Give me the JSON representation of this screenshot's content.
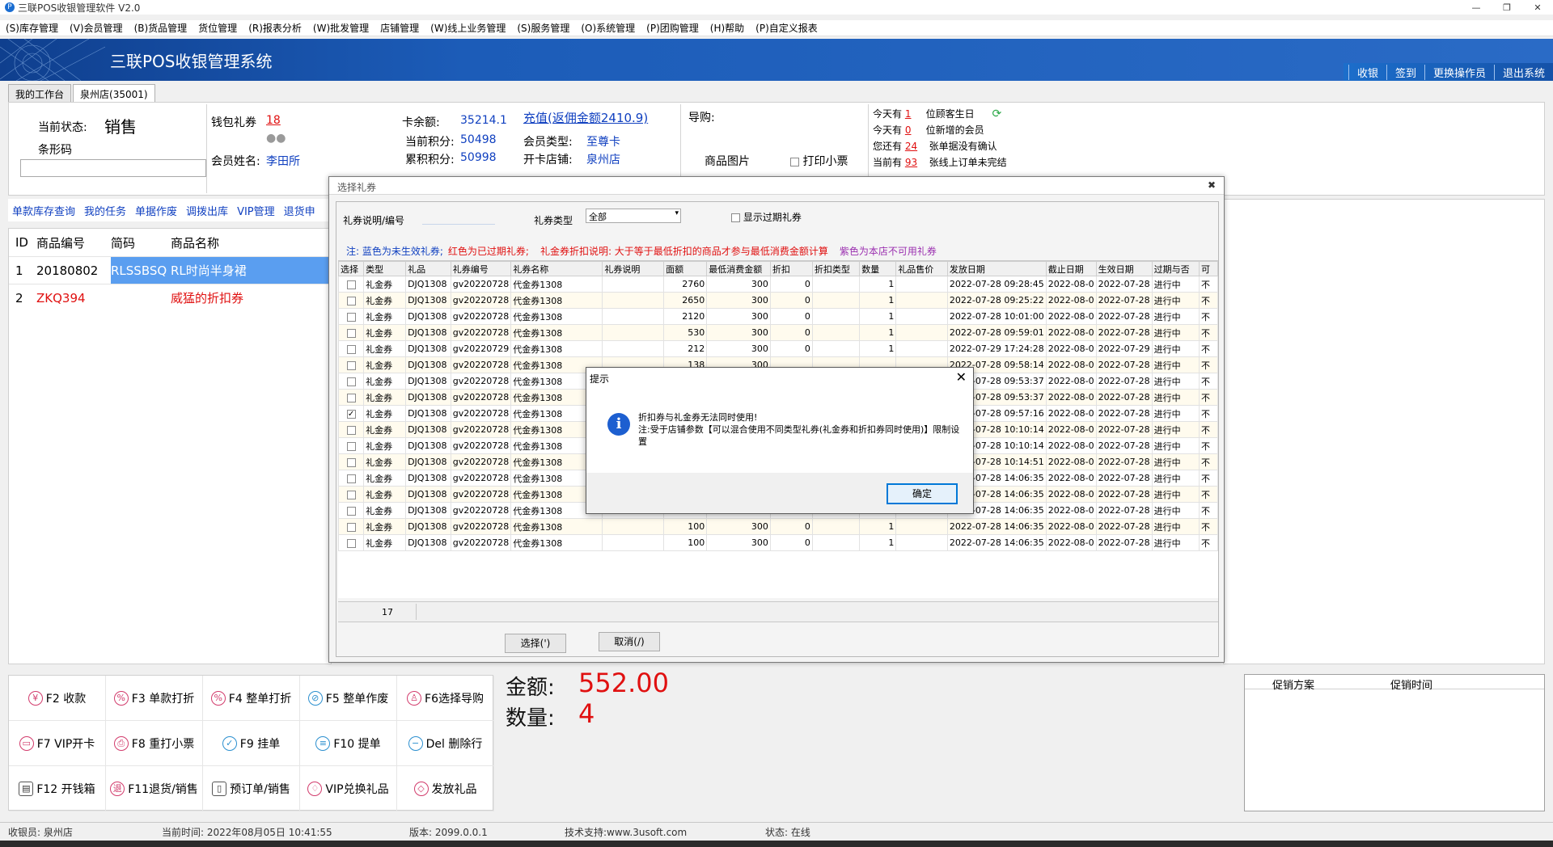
{
  "window": {
    "title": "三联POS收银管理软件 V2.0",
    "minimize": "—",
    "restore": "❐",
    "close": "✕"
  },
  "menu": [
    "(S)库存管理",
    "(V)会员管理",
    "(B)货品管理",
    "货位管理",
    "(R)报表分析",
    "(W)批发管理",
    "店铺管理",
    "(W)线上业务管理",
    "(S)服务管理",
    "(O)系统管理",
    "(P)团购管理",
    "(H)帮助",
    "(P)自定义报表"
  ],
  "banner": {
    "title": "三联POS收银管理系统",
    "links": [
      "收银",
      "签到",
      "更换操作员",
      "退出系统"
    ]
  },
  "tabs": [
    "我的工作台",
    "泉州店(35001)"
  ],
  "status": {
    "state_label": "当前状态:",
    "state_value": "销售",
    "barcode_label": "条形码",
    "wallet_label": "钱包礼券",
    "wallet_value": "18",
    "member_label": "会员姓名:",
    "member_value": "李田所",
    "balance_label": "卡余额:",
    "balance_value": "35214.1",
    "recharge_link": "充值(返佣金额2410.9)",
    "points_label": "当前积分:",
    "points_value": "50498",
    "total_points_label": "累积积分:",
    "total_points_value": "50998",
    "member_type_label": "会员类型:",
    "member_type_value": "至尊卡",
    "store_label": "开卡店铺:",
    "store_value": "泉州店",
    "guide_label": "导购:",
    "product_image_label": "商品图片",
    "print_ticket_label": "打印小票"
  },
  "notices": [
    {
      "prefix": "今天有",
      "count": "1",
      "suffix": "位顾客生日"
    },
    {
      "prefix": "今天有",
      "count": "0",
      "suffix": "位新增的会员"
    },
    {
      "prefix": "您还有",
      "count": "24",
      "suffix": "张单据没有确认"
    },
    {
      "prefix": "当前有",
      "count": "93",
      "suffix": "张线上订单未完结"
    }
  ],
  "toolbar_links": [
    "单款库存查询",
    "我的任务",
    "单据作废",
    "调拨出库",
    "VIP管理",
    "退货申"
  ],
  "product_table": {
    "headers": [
      "ID",
      "商品编号",
      "简码",
      "商品名称"
    ],
    "rows": [
      {
        "id": "1",
        "code": "20180802",
        "short": "RLSSBSQ",
        "name": "RL时尚半身裙"
      },
      {
        "id": "2",
        "code": "ZKQ394",
        "short": "",
        "name": "威猛的折扣券"
      }
    ]
  },
  "fkeys": [
    {
      "icon": "yuan-icon",
      "glyph": "¥",
      "label": "F2 收款"
    },
    {
      "icon": "percent-icon",
      "glyph": "%",
      "label": "F3 单款打折"
    },
    {
      "icon": "percent-icon",
      "glyph": "%",
      "label": "F4 整单打折"
    },
    {
      "icon": "void-icon",
      "glyph": "⊘",
      "label": "F5 整单作废"
    },
    {
      "icon": "person-icon",
      "glyph": "♙",
      "label": "F6选择导购"
    },
    {
      "icon": "vip-card-icon",
      "glyph": "▭",
      "label": "F7 VIP开卡"
    },
    {
      "icon": "reprint-icon",
      "glyph": "⎙",
      "label": "F8 重打小票"
    },
    {
      "icon": "hold-icon",
      "glyph": "✓",
      "label": "F9 挂单"
    },
    {
      "icon": "retrieve-icon",
      "glyph": "≡",
      "label": "F10 提单"
    },
    {
      "icon": "delete-icon",
      "glyph": "−",
      "label": "Del 删除行"
    },
    {
      "icon": "cash-drawer-icon",
      "glyph": "▤",
      "label": "F12 开钱箱"
    },
    {
      "icon": "return-icon",
      "glyph": "退",
      "label": "F11退货/销售"
    },
    {
      "icon": "preorder-icon",
      "glyph": "▯",
      "label": "预订单/销售"
    },
    {
      "icon": "gift-icon",
      "glyph": "♢",
      "label": "VIP兑换礼品"
    },
    {
      "icon": "ticket-icon",
      "glyph": "◇",
      "label": "发放礼品"
    }
  ],
  "totals": {
    "amount_label": "金额:",
    "amount_value": "552.00",
    "qty_label": "数量:",
    "qty_value": "4"
  },
  "promo": {
    "headers": [
      "促销方案",
      "促销时间"
    ]
  },
  "statusbar": {
    "cashier": "收银员: 泉州店",
    "time": "当前时间: 2022年08月05日 10:41:55",
    "version": "版本: 2099.0.0.1",
    "support": "技术支持:www.3usoft.com",
    "state": "状态: 在线"
  },
  "voucher_dialog": {
    "title": "选择礼券",
    "desc_label": "礼券说明/编号",
    "type_label": "礼券类型",
    "type_value": "全部",
    "show_expired_label": "显示过期礼券",
    "notes": [
      "注: 蓝色为未生效礼券;",
      "红色为已过期礼券;",
      "礼金券折扣说明: 大于等于最低折扣的商品才参与最低消费金额计算",
      "紫色为本店不可用礼券"
    ],
    "columns": [
      "选择",
      "类型",
      "礼品",
      "礼券编号",
      "礼券名称",
      "礼券说明",
      "面额",
      "最低消费金额",
      "折扣",
      "折扣类型",
      "数量",
      "礼品售价",
      "发放日期",
      "截止日期",
      "生效日期",
      "过期与否",
      "可"
    ],
    "rows": [
      {
        "checked": false,
        "type": "礼金券",
        "gift": "DJQ1308",
        "code": "gv20220728",
        "name": "代金券1308",
        "value": "2760",
        "min": "300",
        "discount": "0",
        "qty": "1",
        "issue": "2022-07-28 09:28:45",
        "end": "2022-08-0",
        "start": "2022-07-28",
        "status": "进行中",
        "extra": "不"
      },
      {
        "checked": false,
        "type": "礼金券",
        "gift": "DJQ1308",
        "code": "gv20220728",
        "name": "代金券1308",
        "value": "2650",
        "min": "300",
        "discount": "0",
        "qty": "1",
        "issue": "2022-07-28 09:25:22",
        "end": "2022-08-0",
        "start": "2022-07-28",
        "status": "进行中",
        "extra": "不"
      },
      {
        "checked": false,
        "type": "礼金券",
        "gift": "DJQ1308",
        "code": "gv20220728",
        "name": "代金券1308",
        "value": "2120",
        "min": "300",
        "discount": "0",
        "qty": "1",
        "issue": "2022-07-28 10:01:00",
        "end": "2022-08-0",
        "start": "2022-07-28",
        "status": "进行中",
        "extra": "不"
      },
      {
        "checked": false,
        "type": "礼金券",
        "gift": "DJQ1308",
        "code": "gv20220728",
        "name": "代金券1308",
        "value": "530",
        "min": "300",
        "discount": "0",
        "qty": "1",
        "issue": "2022-07-28 09:59:01",
        "end": "2022-08-0",
        "start": "2022-07-28",
        "status": "进行中",
        "extra": "不"
      },
      {
        "checked": false,
        "type": "礼金券",
        "gift": "DJQ1308",
        "code": "gv20220729",
        "name": "代金券1308",
        "value": "212",
        "min": "300",
        "discount": "0",
        "qty": "1",
        "issue": "2022-07-29 17:24:28",
        "end": "2022-08-0",
        "start": "2022-07-29",
        "status": "进行中",
        "extra": "不"
      },
      {
        "checked": false,
        "type": "礼金券",
        "gift": "DJQ1308",
        "code": "gv20220728",
        "name": "代金券1308",
        "value": "138",
        "min": "300",
        "discount": "",
        "qty": "",
        "issue": "2022-07-28 09:58:14",
        "end": "2022-08-0",
        "start": "2022-07-28",
        "status": "进行中",
        "extra": "不"
      },
      {
        "checked": false,
        "type": "礼金券",
        "gift": "DJQ1308",
        "code": "gv20220728",
        "name": "代金券1308",
        "value": "",
        "min": "",
        "discount": "",
        "qty": "",
        "issue": "2022-07-28 09:53:37",
        "end": "2022-08-0",
        "start": "2022-07-28",
        "status": "进行中",
        "extra": "不"
      },
      {
        "checked": false,
        "type": "礼金券",
        "gift": "DJQ1308",
        "code": "gv20220728",
        "name": "代金券1308",
        "value": "",
        "min": "",
        "discount": "",
        "qty": "",
        "issue": "2022-07-28 09:53:37",
        "end": "2022-08-0",
        "start": "2022-07-28",
        "status": "进行中",
        "extra": "不"
      },
      {
        "checked": true,
        "type": "礼金券",
        "gift": "DJQ1308",
        "code": "gv20220728",
        "name": "代金券1308",
        "value": "",
        "min": "",
        "discount": "",
        "qty": "",
        "issue": "2022-07-28 09:57:16",
        "end": "2022-08-0",
        "start": "2022-07-28",
        "status": "进行中",
        "extra": "不"
      },
      {
        "checked": false,
        "type": "礼金券",
        "gift": "DJQ1308",
        "code": "gv20220728",
        "name": "代金券1308",
        "value": "",
        "min": "",
        "discount": "",
        "qty": "",
        "issue": "2022-07-28 10:10:14",
        "end": "2022-08-0",
        "start": "2022-07-28",
        "status": "进行中",
        "extra": "不"
      },
      {
        "checked": false,
        "type": "礼金券",
        "gift": "DJQ1308",
        "code": "gv20220728",
        "name": "代金券1308",
        "value": "",
        "min": "",
        "discount": "",
        "qty": "",
        "issue": "2022-07-28 10:10:14",
        "end": "2022-08-0",
        "start": "2022-07-28",
        "status": "进行中",
        "extra": "不"
      },
      {
        "checked": false,
        "type": "礼金券",
        "gift": "DJQ1308",
        "code": "gv20220728",
        "name": "代金券1308",
        "value": "",
        "min": "",
        "discount": "",
        "qty": "",
        "issue": "2022-07-28 10:14:51",
        "end": "2022-08-0",
        "start": "2022-07-28",
        "status": "进行中",
        "extra": "不"
      },
      {
        "checked": false,
        "type": "礼金券",
        "gift": "DJQ1308",
        "code": "gv20220728",
        "name": "代金券1308",
        "value": "",
        "min": "",
        "discount": "",
        "qty": "",
        "issue": "2022-07-28 14:06:35",
        "end": "2022-08-0",
        "start": "2022-07-28",
        "status": "进行中",
        "extra": "不"
      },
      {
        "checked": false,
        "type": "礼金券",
        "gift": "DJQ1308",
        "code": "gv20220728",
        "name": "代金券1308",
        "value": "",
        "min": "",
        "discount": "",
        "qty": "",
        "issue": "2022-07-28 14:06:35",
        "end": "2022-08-0",
        "start": "2022-07-28",
        "status": "进行中",
        "extra": "不"
      },
      {
        "checked": false,
        "type": "礼金券",
        "gift": "DJQ1308",
        "code": "gv20220728",
        "name": "代金券1308",
        "value": "",
        "min": "",
        "discount": "",
        "qty": "",
        "issue": "2022-07-28 14:06:35",
        "end": "2022-08-0",
        "start": "2022-07-28",
        "status": "进行中",
        "extra": "不"
      },
      {
        "checked": false,
        "type": "礼金券",
        "gift": "DJQ1308",
        "code": "gv20220728",
        "name": "代金券1308",
        "value": "100",
        "min": "300",
        "discount": "0",
        "qty": "1",
        "issue": "2022-07-28 14:06:35",
        "end": "2022-08-0",
        "start": "2022-07-28",
        "status": "进行中",
        "extra": "不"
      },
      {
        "checked": false,
        "type": "礼金券",
        "gift": "DJQ1308",
        "code": "gv20220728",
        "name": "代金券1308",
        "value": "100",
        "min": "300",
        "discount": "0",
        "qty": "1",
        "issue": "2022-07-28 14:06:35",
        "end": "2022-08-0",
        "start": "2022-07-28",
        "status": "进行中",
        "extra": "不"
      }
    ],
    "footer_count": "17",
    "select_button": "选择(')",
    "cancel_button": "取消(/)"
  },
  "hint_dialog": {
    "title": "提示",
    "close": "✕",
    "icon_glyph": "i",
    "line1": "折扣券与礼金券无法同时使用!",
    "line2": "注:受于店铺参数【可以混合使用不同类型礼券(礼金券和折扣券同时使用)】限制设置",
    "ok_button": "确定"
  },
  "colors": {
    "banner": "#1c5cb8",
    "accent_red": "#e01010",
    "link_blue": "#1040c0",
    "selected_row": "#5a9ef0",
    "note_blue": "#1040c0",
    "note_red": "#e01010",
    "note_purple": "#9b30b0"
  }
}
